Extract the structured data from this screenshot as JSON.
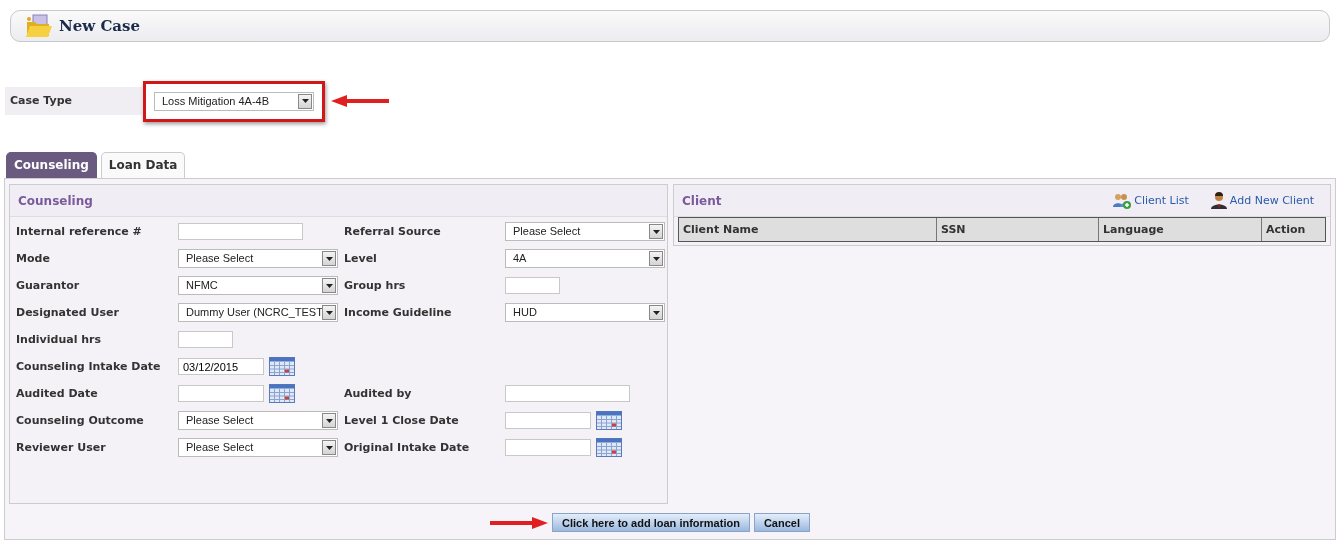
{
  "header": {
    "title": "New Case"
  },
  "case_type": {
    "label": "Case Type",
    "value": "Loss Mitigation 4A-4B",
    "highlighted": true
  },
  "tabs": [
    {
      "label": "Counseling",
      "selected": true
    },
    {
      "label": "Loan Data",
      "selected": false
    }
  ],
  "counseling": {
    "title": "Counseling",
    "rows": [
      {
        "left": {
          "label": "Internal reference #",
          "kind": "text"
        },
        "right": {
          "label": "Referral Source",
          "kind": "select",
          "value": "Please Select"
        }
      },
      {
        "left": {
          "label": "Mode",
          "kind": "select",
          "value": "Please Select"
        },
        "right": {
          "label": "Level",
          "kind": "select",
          "value": "4A"
        }
      },
      {
        "left": {
          "label": "Guarantor",
          "kind": "select",
          "value": "NFMC"
        },
        "right": {
          "label": "Group hrs",
          "kind": "short"
        }
      },
      {
        "left": {
          "label": "Designated User",
          "kind": "select",
          "value": "Dummy User (NCRC_TEST"
        },
        "right": {
          "label": "Income Guideline",
          "kind": "select",
          "value": "HUD"
        }
      },
      {
        "left": {
          "label": "Individual hrs",
          "kind": "short"
        }
      },
      {
        "left": {
          "label": "Counseling Intake Date",
          "kind": "date",
          "value": "03/12/2015"
        }
      },
      {
        "left": {
          "label": "Audited Date",
          "kind": "date"
        },
        "right": {
          "label": "Audited by",
          "kind": "text"
        }
      },
      {
        "left": {
          "label": "Counseling Outcome",
          "kind": "select",
          "value": "Please Select"
        },
        "right": {
          "label": "Level 1 Close Date",
          "kind": "date"
        }
      },
      {
        "left": {
          "label": "Reviewer User",
          "kind": "select",
          "value": "Please Select"
        },
        "right": {
          "label": "Original Intake Date",
          "kind": "date"
        }
      }
    ]
  },
  "client": {
    "title": "Client",
    "actions": [
      {
        "label": "Client List",
        "kind": "list"
      },
      {
        "label": "Add New Client",
        "kind": "add"
      }
    ],
    "table": {
      "columns": [
        "Client Name",
        "SSN",
        "Language",
        "Action"
      ]
    }
  },
  "buttons": [
    {
      "label": "Click here to add loan information",
      "pointed": true
    },
    {
      "label": "Cancel",
      "pointed": false
    }
  ]
}
